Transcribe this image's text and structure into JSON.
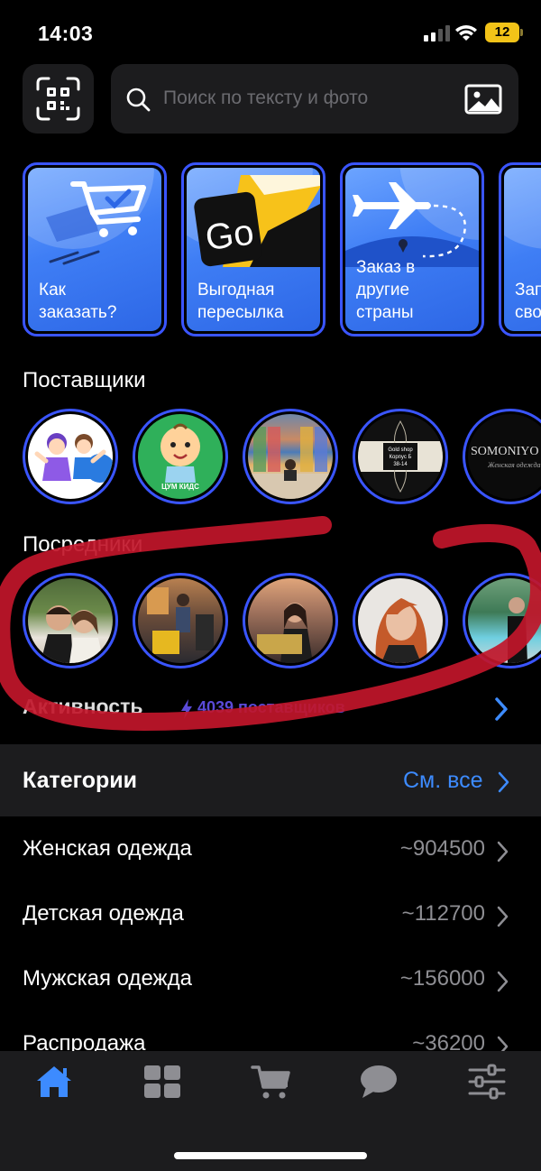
{
  "status_bar": {
    "time": "14:03",
    "battery": "12"
  },
  "search": {
    "placeholder": "Поиск по тексту и фото"
  },
  "promo_cards": [
    {
      "label": "Как заказать?"
    },
    {
      "label": "Выгодная пересылка"
    },
    {
      "label": "Заказ в другие страны"
    },
    {
      "label": "Зап сво"
    }
  ],
  "suppliers": {
    "title": "Поставщики",
    "items": [
      {
        "caption": ""
      },
      {
        "caption": "ЦУМ КИДС"
      },
      {
        "caption": ""
      },
      {
        "caption": "Gold shop Корпус Б 38-14"
      },
      {
        "caption": "SOMONIYO",
        "sub": "Женская одежда"
      }
    ]
  },
  "mediators": {
    "title": "Посредники"
  },
  "activity": {
    "title": "Активность",
    "count": "4039 поставщиков"
  },
  "categories": {
    "title": "Категории",
    "see_all": "См. все",
    "items": [
      {
        "name": "Женская одежда",
        "count": "~904500"
      },
      {
        "name": "Детская одежда",
        "count": "~112700"
      },
      {
        "name": "Мужская одежда",
        "count": "~156000"
      },
      {
        "name": "Распродажа",
        "count": "~36200"
      }
    ]
  },
  "tabbar": {
    "items": [
      "home-icon",
      "grid-icon",
      "cart-icon",
      "chat-icon",
      "filters-icon"
    ],
    "active": "home-icon"
  },
  "colors": {
    "accent": "#3d8bff",
    "ring": "#3a55ff",
    "card_blue": "#3f7ef5",
    "scribble": "#c1162a"
  }
}
